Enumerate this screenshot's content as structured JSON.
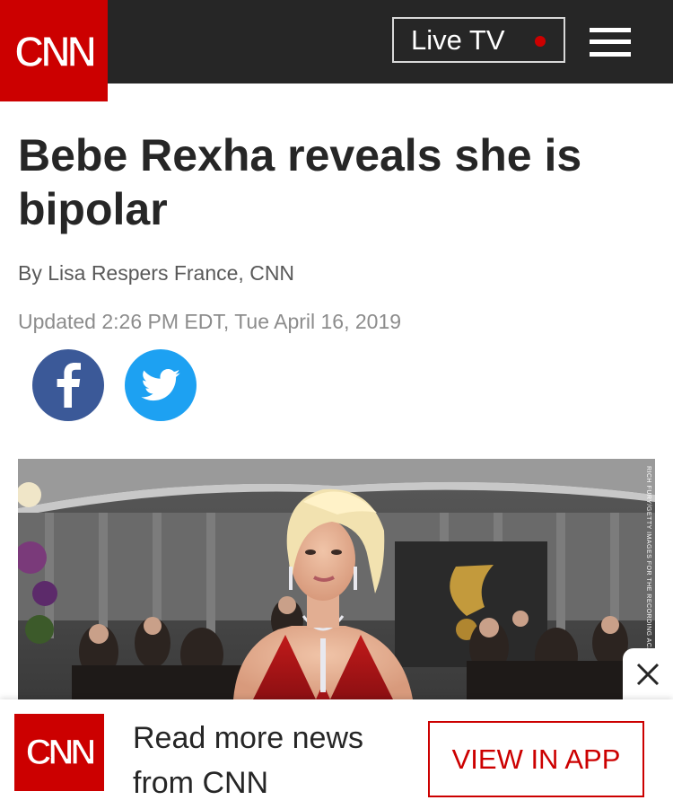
{
  "header": {
    "logo_text": "CNN",
    "live_label": "Live TV",
    "brand_red": "#cc0000",
    "bar_color": "#262626"
  },
  "article": {
    "headline": "Bebe Rexha reveals she is bipolar",
    "byline_prefix": "By ",
    "byline_author": "Lisa Respers France, CNN",
    "updated": "Updated 2:26 PM EDT, Tue April 16, 2019",
    "image_credit": "RICH FURY/GETTY IMAGES FOR THE RECORDING ACADEMY"
  },
  "share": {
    "facebook_icon": "facebook-icon",
    "twitter_icon": "twitter-icon"
  },
  "promo": {
    "logo_text": "CNN",
    "message": "Read more news from CNN",
    "button_label": "VIEW IN APP",
    "close_icon": "close-icon"
  }
}
